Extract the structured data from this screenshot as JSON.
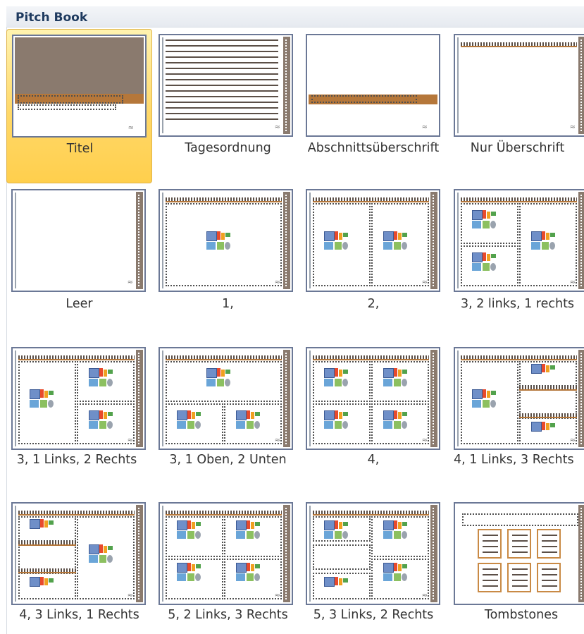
{
  "gallery": {
    "title": "Pitch Book",
    "layouts": [
      {
        "label": "Titel",
        "selected": true
      },
      {
        "label": "Tagesordnung",
        "selected": false
      },
      {
        "label": "Abschnittsüberschrift",
        "selected": false
      },
      {
        "label": "Nur Überschrift",
        "selected": false
      },
      {
        "label": "Leer",
        "selected": false
      },
      {
        "label": "1,",
        "selected": false
      },
      {
        "label": "2,",
        "selected": false
      },
      {
        "label": "3, 2 links, 1 rechts",
        "selected": false
      },
      {
        "label": "3, 1 Links, 2 Rechts",
        "selected": false
      },
      {
        "label": "3, 1 Oben, 2 Unten",
        "selected": false
      },
      {
        "label": "4,",
        "selected": false
      },
      {
        "label": "4, 1 Links, 3 Rechts",
        "selected": false
      },
      {
        "label": "4, 3 Links, 1 Rechts",
        "selected": false
      },
      {
        "label": "5, 2 Links, 3 Rechts",
        "selected": false
      },
      {
        "label": "5, 3 Links, 2 Rechts",
        "selected": false
      },
      {
        "label": "Tombstones",
        "selected": false
      }
    ]
  },
  "colors": {
    "accent_brown": "#8a7a6e",
    "accent_orange": "#b5773a",
    "selection": "#ffd868",
    "header_text": "#1e3a5f"
  }
}
